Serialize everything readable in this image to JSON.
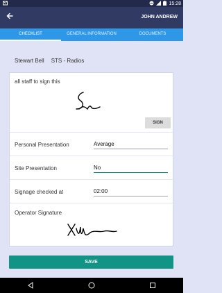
{
  "status_bar": {
    "time": "15:28"
  },
  "app_bar": {
    "user_name": "JOHN ANDREW"
  },
  "tabs": [
    {
      "label": "CHECKLIST",
      "active": true
    },
    {
      "label": "GENERAL INFORMATION",
      "active": false
    },
    {
      "label": "DOCUMENTS",
      "active": false
    }
  ],
  "header": {
    "person": "Stewart Bell",
    "company": "STS - Radios"
  },
  "form": {
    "sign_prompt": "all staff to sign this",
    "sign_button": "SIGN",
    "personal_presentation": {
      "label": "Personal Presentation",
      "value": "Average"
    },
    "site_presentation": {
      "label": "Site Presentation",
      "value": "No"
    },
    "signage_checked": {
      "label": "Signage checked at",
      "value": "02:00"
    },
    "operator_signature_label": "Operator Signature"
  },
  "save_button": "SAVE"
}
